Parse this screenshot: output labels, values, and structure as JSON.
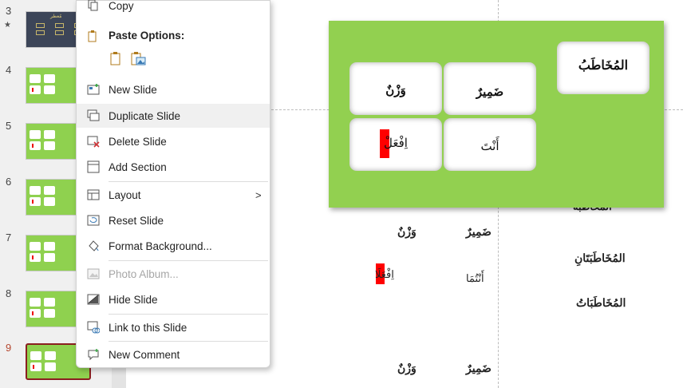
{
  "thumbnails": [
    {
      "number": "3",
      "marker": "★",
      "style": "dark",
      "caption": "مُعطر"
    },
    {
      "number": "4"
    },
    {
      "number": "5"
    },
    {
      "number": "6"
    },
    {
      "number": "7"
    },
    {
      "number": "8"
    },
    {
      "number": "9",
      "active": true
    }
  ],
  "context_menu": {
    "copy": "Copy",
    "paste_options": "Paste Options:",
    "items": [
      {
        "label": "New Slide",
        "icon": "new-slide-icon"
      },
      {
        "label": "Duplicate Slide",
        "icon": "duplicate-slide-icon"
      },
      {
        "label": "Delete Slide",
        "icon": "delete-slide-icon"
      },
      {
        "label": "Add Section",
        "icon": "add-section-icon"
      },
      {
        "label": "Layout",
        "icon": "layout-icon",
        "submenu_arrow": ">"
      },
      {
        "label": "Reset Slide",
        "icon": "reset-slide-icon"
      },
      {
        "label": "Format Background...",
        "icon": "format-background-icon"
      },
      {
        "label": "Photo Album...",
        "icon": "photo-album-icon",
        "disabled": true
      },
      {
        "label": "Hide Slide",
        "icon": "hide-slide-icon"
      },
      {
        "label": "Link to this Slide",
        "icon": "link-to-slide-icon"
      },
      {
        "label": "New Comment",
        "icon": "new-comment-icon"
      }
    ]
  },
  "slide": {
    "background_color": "#92d050",
    "header": "المُخَاطَبُ",
    "cards": {
      "wazn": "وَزْنٌ",
      "damir": "ضَمِيرٌ",
      "ifal": "اِفْعَلْ",
      "anta": "أَنْتَ"
    }
  },
  "background_slide": {
    "row1_right": "المخاطبة",
    "row1_wazn": "وَزْنٌ",
    "row1_damir": "ضَمِيرٌ",
    "row2_right": "المُخَاطَبَتَانِ",
    "row2_ifal": "اِفْعَلَا",
    "row2_antuma": "أَنْتُمَا",
    "row3_right": "المُخَاطَبَاتُ",
    "row4_wazn": "وَزْنٌ",
    "row4_damir": "ضَمِيرٌ"
  },
  "colors": {
    "slide_green": "#92d050",
    "highlight_red": "#ff0000",
    "active_slide_border": "#8a1f1f"
  }
}
